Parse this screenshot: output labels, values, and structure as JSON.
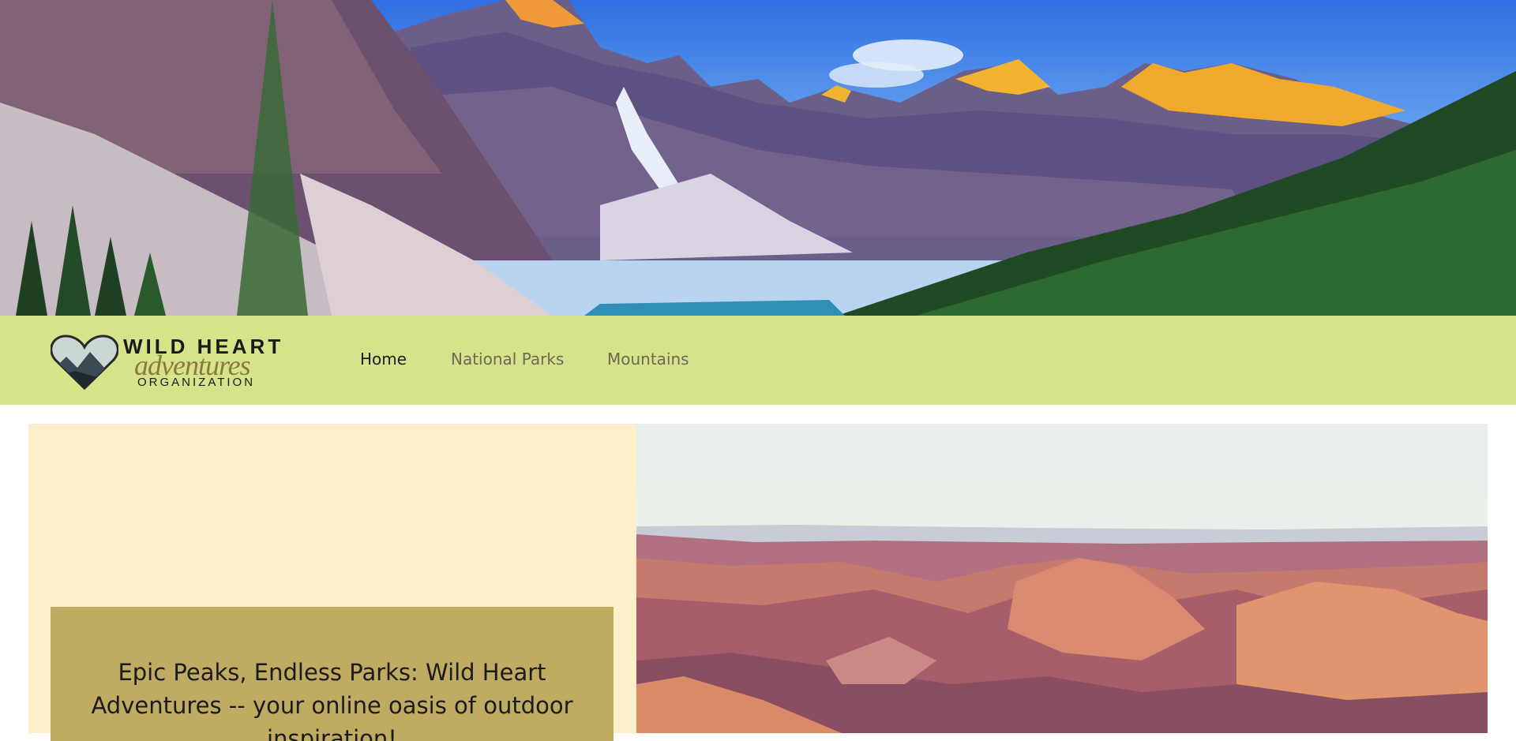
{
  "nav": {
    "logo": {
      "line1": "WILD HEART",
      "line2": "adventures",
      "line3": "ORGANIZATION"
    },
    "links": [
      {
        "label": "Home",
        "active": true
      },
      {
        "label": "National Parks",
        "active": false
      },
      {
        "label": "Mountains",
        "active": false
      }
    ]
  },
  "hero": {
    "image": "mountain-lake-landscape"
  },
  "main": {
    "tagline": "Epic Peaks, Endless Parks: Wild Heart Adventures -- your online oasis of outdoor inspiration!",
    "feature_image": "canyon-landscape"
  },
  "colors": {
    "nav_bg": "#d6e38a",
    "panel_bg": "#fcefc9",
    "tagline_bg": "#bfab62",
    "text": "#1d1d1d",
    "link_muted": "#6a6a55"
  }
}
